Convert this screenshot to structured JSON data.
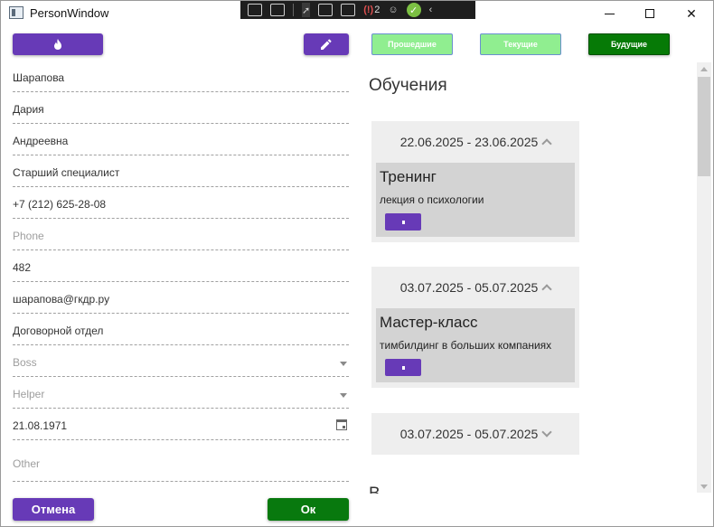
{
  "window": {
    "title": "PersonWindow"
  },
  "debug_toolbar": {
    "items": [
      "select-element-icon",
      "preview-icon",
      "selection-arrow-icon",
      "layout-adorner-icon",
      "hot-reload-icon",
      "binding-failures-icon",
      "accessibility-icon",
      "checked-icon",
      "collapse-icon"
    ],
    "binding_failures": "2"
  },
  "form": {
    "fire_button_icon": "fire-icon",
    "edit_button_icon": "pencil-icon",
    "fields": {
      "last_name": "Шарапова",
      "first_name": "Дария",
      "patronymic": "Андреевна",
      "position": "Старший специалист",
      "work_phone": "+7 (212) 625-28-08",
      "phone_placeholder": "Phone",
      "room": "482",
      "email": "шарапова@гкдр.ру",
      "department": "Договорной отдел",
      "boss_placeholder": "Boss",
      "helper_placeholder": "Helper",
      "birthday": "21.08.1971",
      "other_placeholder": "Other"
    },
    "cancel_label": "Отмена",
    "ok_label": "Ок"
  },
  "trainings": {
    "filters": {
      "past": "Прошедшие",
      "current": "Текущие",
      "future": "Будущие"
    },
    "title": "Обучения",
    "cards": [
      {
        "dates": "22.06.2025 - 23.06.2025",
        "expanded": true,
        "name": "Тренинг",
        "description": "лекция о психологии"
      },
      {
        "dates": "03.07.2025 - 05.07.2025",
        "expanded": true,
        "name": "Мастер-класс",
        "description": "тимбилдинг в больших компаниях"
      },
      {
        "dates": "03.07.2025 - 05.07.2025",
        "expanded": false
      }
    ],
    "next_section_partial": "В"
  },
  "colors": {
    "primary": "#673ab7",
    "ok": "#08790e",
    "filter_inactive": "#90ee90",
    "filter_active": "#067a06"
  }
}
